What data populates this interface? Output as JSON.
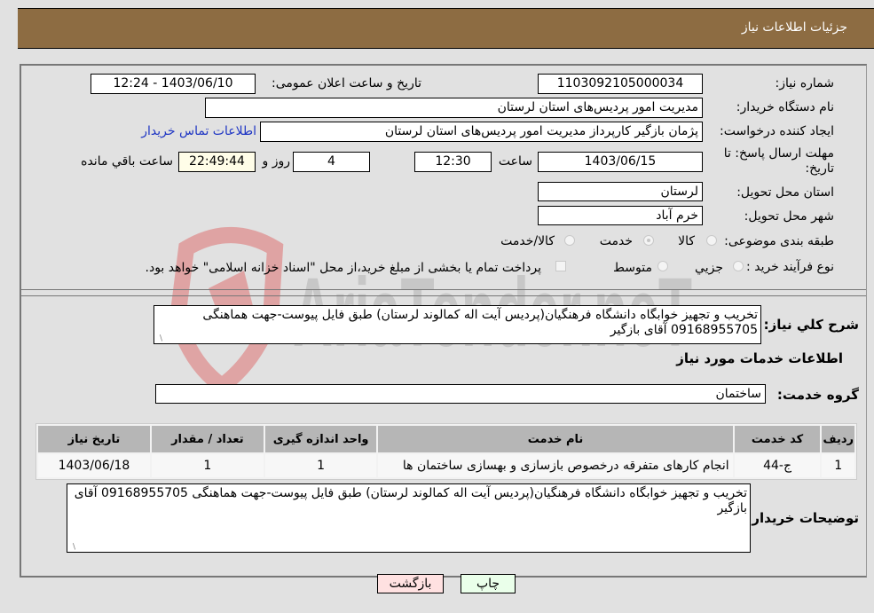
{
  "header": {
    "title": "جزئیات اطلاعات نیاز"
  },
  "form": {
    "need_number": {
      "label": "شماره نیاز:",
      "value": "1103092105000034"
    },
    "announce_datetime": {
      "label": "تاریخ و ساعت اعلان عمومی:",
      "value": "1403/06/10 - 12:24"
    },
    "buyer_org": {
      "label": "نام دستگاه خریدار:",
      "value": "مدیریت امور پردیس‌های استان لرستان"
    },
    "requester": {
      "label": "ایجاد کننده درخواست:",
      "value": "پژمان بازگیر کارپرداز  مدیریت امور پردیس‌های استان لرستان"
    },
    "contact_link": "اطلاعات تماس خریدار",
    "deadline": {
      "label_line1": "مهلت ارسال پاسخ: تا",
      "label_line2": "تاریخ:",
      "date": "1403/06/15",
      "time_label": "ساعت",
      "time": "12:30",
      "days": "4",
      "days_label": "روز و",
      "remaining": "22:49:44",
      "remaining_label": "ساعت باقي مانده"
    },
    "delivery_province": {
      "label": "استان محل تحویل:",
      "value": "لرستان"
    },
    "delivery_city": {
      "label": "شهر محل تحویل:",
      "value": "خرم آباد"
    },
    "category": {
      "label": "طبقه بندی موضوعی:",
      "options": [
        "کالا",
        "خدمت",
        "کالا/خدمت"
      ],
      "selected": "خدمت"
    },
    "purchase_type": {
      "label": "نوع فرآیند خرید :",
      "options": [
        "جزيي",
        "متوسط"
      ],
      "payment_note": "پرداخت تمام یا بخشی از مبلغ خرید،از محل \"اسناد خزانه اسلامی\" خواهد بود."
    },
    "description": {
      "label": "شرح كلي نياز:",
      "value": "تخریب و تجهیز خوابگاه دانشگاه فرهنگیان(پردیس آیت اله کمالوند لرستان) طبق فایل پیوست-جهت هماهنگی 09168955705 آقای بازگیر"
    },
    "services_heading": "اطلاعات خدمات مورد نياز",
    "service_group": {
      "label": "گروه خدمت:",
      "value": "ساختمان"
    }
  },
  "table": {
    "headers": [
      "رديف",
      "کد خدمت",
      "نام خدمت",
      "واحد اندازه گيری",
      "تعداد / مقدار",
      "تاريخ نياز"
    ],
    "rows": [
      [
        "1",
        "ج-44",
        "انجام کارهای متفرقه درخصوص بازسازی و بهسازی ساختمان ها",
        "1",
        "1",
        "1403/06/18"
      ]
    ]
  },
  "buyer_notes": {
    "label": "توضیحات خریدار:",
    "value": "تخریب و تجهیز خوابگاه دانشگاه فرهنگیان(پردیس آیت اله کمالوند لرستان) طبق فایل پیوست-جهت هماهنگی 09168955705 آقای بازگیر"
  },
  "buttons": {
    "print": "چاپ",
    "back": "بازگشت"
  },
  "colors": {
    "header_bg": "#8d6c42",
    "page_bg": "#e1e1e1",
    "link": "#1f36c4",
    "print_bg": "#eaffea",
    "back_bg": "#ffe1e1",
    "remaining_bg": "#fffde8"
  },
  "watermark": {
    "text": "AriaTender.neT"
  }
}
